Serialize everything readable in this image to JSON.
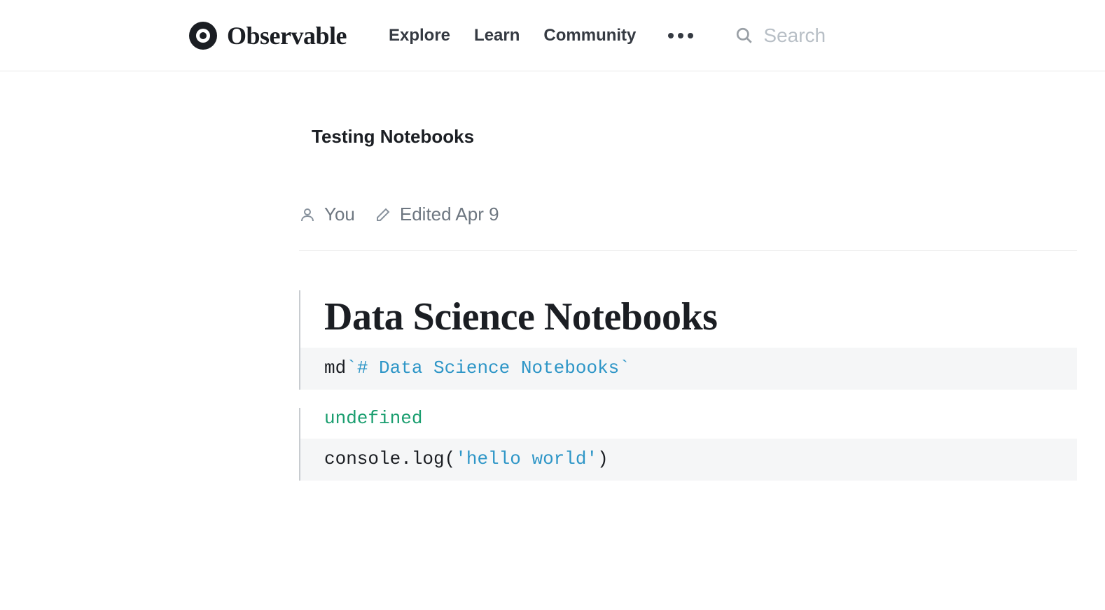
{
  "header": {
    "brand": "Observable",
    "nav": {
      "explore": "Explore",
      "learn": "Learn",
      "community": "Community"
    },
    "search_placeholder": "Search"
  },
  "breadcrumb": "Testing Notebooks",
  "meta": {
    "author": "You",
    "edited": "Edited Apr 9"
  },
  "cells": [
    {
      "title": "Data Science Notebooks",
      "code_prefix": "md",
      "code_template": "`# Data Science Notebooks`"
    },
    {
      "output": "undefined",
      "code_obj": "console",
      "code_dot": ".",
      "code_fn": "log",
      "code_open": "(",
      "code_str": "'hello world'",
      "code_close": ")"
    }
  ]
}
